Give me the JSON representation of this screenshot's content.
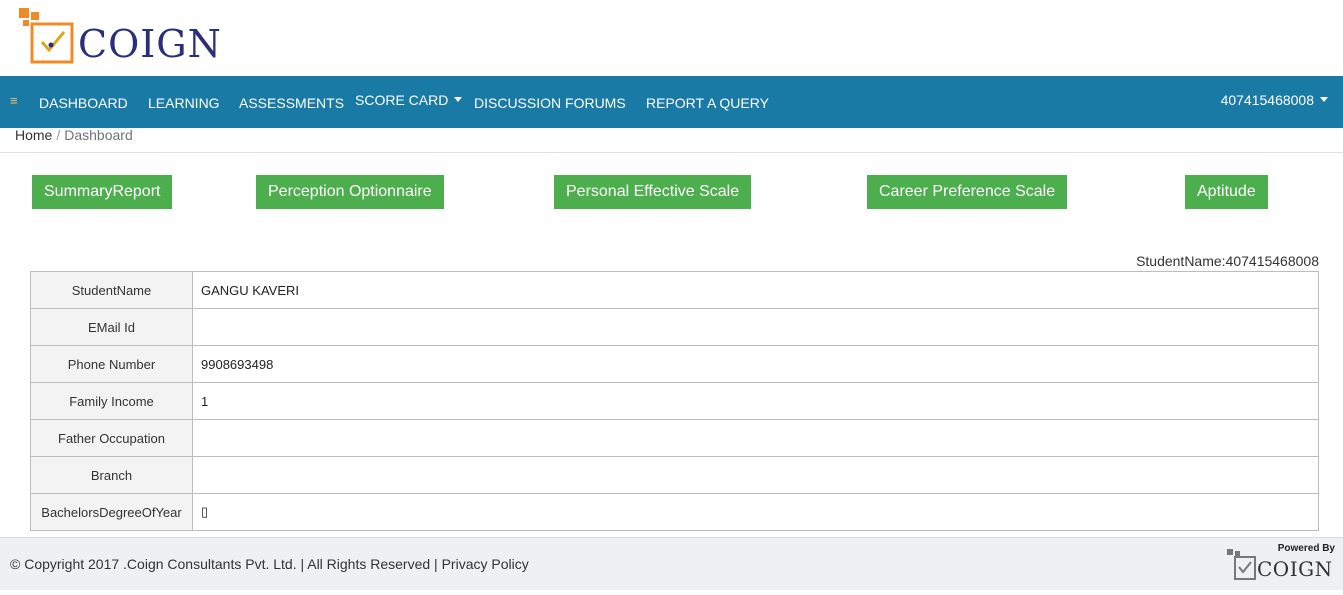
{
  "brand": {
    "logo_text": "COIGN",
    "colors": {
      "orange": "#f08a24",
      "navy": "#2b2e7a",
      "nav_bg": "#1a7aa6",
      "button_green": "#4cae4c"
    }
  },
  "nav": {
    "toggle_icon": "≡",
    "items": [
      {
        "label": "DASHBOARD"
      },
      {
        "label": "LEARNING"
      },
      {
        "label": "ASSESSMENTS"
      },
      {
        "label": "SCORE CARD"
      },
      {
        "label": "DISCUSSION FORUMS"
      },
      {
        "label": "REPORT A QUERY"
      }
    ],
    "user": "407415468008"
  },
  "breadcrumb": {
    "home": "Home",
    "separator": "/",
    "current": "Dashboard"
  },
  "report_buttons": [
    {
      "label": "SummaryReport"
    },
    {
      "label": "Perception Optionnaire"
    },
    {
      "label": "Personal Effective Scale"
    },
    {
      "label": "Career Preference Scale"
    },
    {
      "label": "Aptitude"
    }
  ],
  "student_name_label": "StudentName:407415468008",
  "student_info": [
    {
      "label": "StudentName",
      "value": "GANGU KAVERI"
    },
    {
      "label": "EMail Id",
      "value": ""
    },
    {
      "label": "Phone Number",
      "value": "9908693498"
    },
    {
      "label": "Family Income",
      "value": "1"
    },
    {
      "label": "Father Occupation",
      "value": ""
    },
    {
      "label": "Branch",
      "value": ""
    },
    {
      "label": "BachelorsDegreeOfYear",
      "value": "▯"
    }
  ],
  "footer": {
    "copyright": "© Copyright 2017 .Coign Consultants Pvt. Ltd. | All Rights Reserved | Privacy Policy",
    "powered_by": "Powered By",
    "powered_logo_text": "COIGN"
  }
}
